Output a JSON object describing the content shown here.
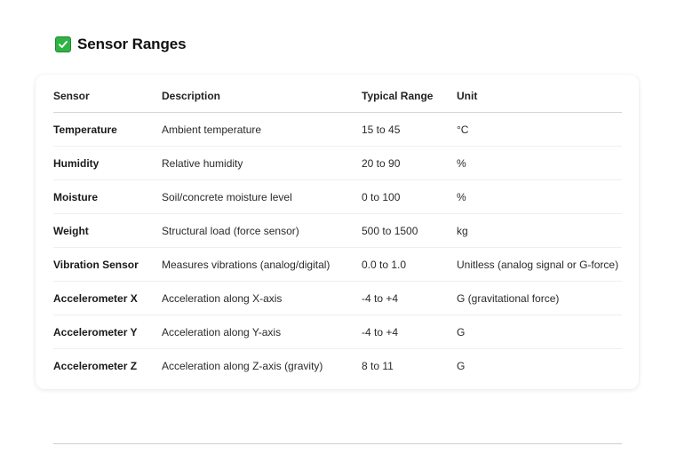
{
  "heading": {
    "icon": "check-box-icon",
    "icon_color": "#2fb344",
    "title": "Sensor Ranges"
  },
  "table": {
    "columns": [
      "Sensor",
      "Description",
      "Typical Range",
      "Unit"
    ],
    "rows": [
      {
        "sensor": "Temperature",
        "description": "Ambient temperature",
        "range": "15 to 45",
        "unit": "°C"
      },
      {
        "sensor": "Humidity",
        "description": "Relative humidity",
        "range": "20 to 90",
        "unit": "%"
      },
      {
        "sensor": "Moisture",
        "description": "Soil/concrete moisture level",
        "range": "0 to 100",
        "unit": "%"
      },
      {
        "sensor": "Weight",
        "description": "Structural load (force sensor)",
        "range": "500 to 1500",
        "unit": "kg"
      },
      {
        "sensor": "Vibration Sensor",
        "description": "Measures vibrations (analog/digital)",
        "range": "0.0 to 1.0",
        "unit": "Unitless (analog signal or G-force)"
      },
      {
        "sensor": "Accelerometer X",
        "description": "Acceleration along X-axis",
        "range": "-4 to +4",
        "unit": "G (gravitational force)"
      },
      {
        "sensor": "Accelerometer Y",
        "description": "Acceleration along Y-axis",
        "range": "-4 to +4",
        "unit": "G"
      },
      {
        "sensor": "Accelerometer Z",
        "description": "Acceleration along Z-axis (gravity)",
        "range": "8 to 11",
        "unit": "G"
      }
    ]
  }
}
